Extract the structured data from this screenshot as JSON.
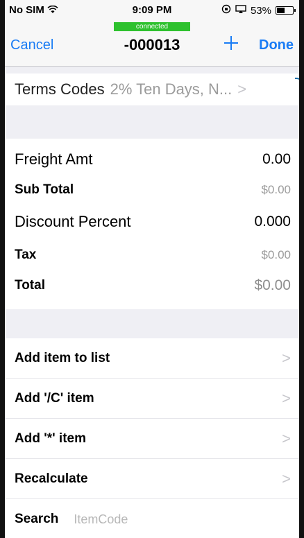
{
  "status_bar": {
    "carrier": "No SIM",
    "wifi_icon": "wifi-icon",
    "time": "9:09 PM",
    "battery_percent": "53%",
    "battery_level": 0.53
  },
  "nav": {
    "connection_badge": "connected",
    "cancel_label": "Cancel",
    "title": "-000013",
    "add_icon": "plus-icon",
    "done_label": "Done"
  },
  "terms": {
    "label": "Terms Codes",
    "value": "2% Ten Days, N...",
    "chevron": ">"
  },
  "totals": [
    {
      "label": "Freight Amt",
      "value": "0.00"
    },
    {
      "label": "Sub Total",
      "value": "$0.00"
    },
    {
      "label": "Discount Percent",
      "value": "0.000"
    },
    {
      "label": "Tax",
      "value": "$0.00"
    },
    {
      "label": "Total",
      "value": "$0.00"
    }
  ],
  "actions": [
    {
      "label": "Add item to list",
      "chevron": ">"
    },
    {
      "label": "Add '/C' item",
      "chevron": ">"
    },
    {
      "label": "Add '*' item",
      "chevron": ">"
    },
    {
      "label": "Recalculate",
      "chevron": ">"
    }
  ],
  "search": {
    "label": "Search",
    "placeholder": "ItemCode"
  },
  "colors": {
    "accent": "#1a7cf5",
    "connected": "#2ec12e",
    "background": "#efeff4"
  }
}
